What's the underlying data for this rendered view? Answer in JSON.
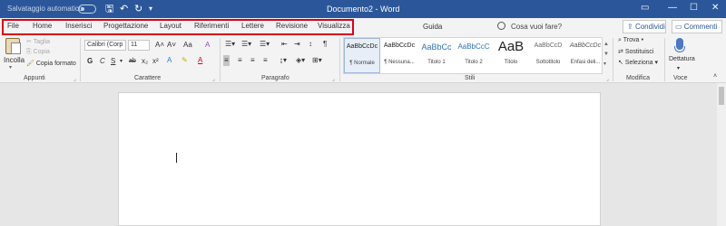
{
  "titlebar": {
    "autosave_label": "Salvataggio automatico",
    "doc_title": "Documento2  -  Word",
    "save_icon": "save-icon",
    "undo_icon": "undo-icon",
    "redo_icon": "redo-icon",
    "minimize": "—",
    "maximize": "☐",
    "close": "✕"
  },
  "tabs": [
    "File",
    "Home",
    "Inserisci",
    "Progettazione",
    "Layout",
    "Riferimenti",
    "Lettere",
    "Revisione",
    "Visualizza"
  ],
  "tabbar": {
    "help": "Guida",
    "search_placeholder": "Cosa vuoi fare?",
    "share": "Condividi",
    "comments": "Commenti"
  },
  "clipboard": {
    "paste": "Incolla",
    "cut": "Taglia",
    "copy": "Copia",
    "format_painter": "Copia formato",
    "group_label": "Appunti"
  },
  "font": {
    "font_name": "Calibri (Corp",
    "font_size": "11",
    "group_label": "Carattere",
    "bold": "G",
    "italic": "C",
    "underline": "S",
    "strike": "ab",
    "subscript": "x₂",
    "superscript": "x²",
    "grow": "A˄",
    "shrink": "A˅",
    "case": "Aa",
    "clear": "A"
  },
  "paragraph": {
    "group_label": "Paragrafo",
    "show_marks": "¶"
  },
  "styles": {
    "group_label": "Stili",
    "items": [
      {
        "sample": "AaBbCcDc",
        "name": "¶ Normale"
      },
      {
        "sample": "AaBbCcDc",
        "name": "¶ Nessuna..."
      },
      {
        "sample": "AaBbCc",
        "name": "Titolo 1"
      },
      {
        "sample": "AaBbCcC",
        "name": "Titolo 2"
      },
      {
        "sample": "AaB",
        "name": "Titolo"
      },
      {
        "sample": "AaBbCcD",
        "name": "Sottotitolo"
      },
      {
        "sample": "AaBbCcDc",
        "name": "Enfasi deli..."
      }
    ]
  },
  "editing": {
    "find": "Trova",
    "replace": "Sostituisci",
    "select": "Seleziona",
    "group_label": "Modifica"
  },
  "voice": {
    "dictate": "Dettatura",
    "group_label": "Voce"
  },
  "colors": {
    "title_bar": "#2b579a",
    "highlight_box": "#d9001b"
  }
}
